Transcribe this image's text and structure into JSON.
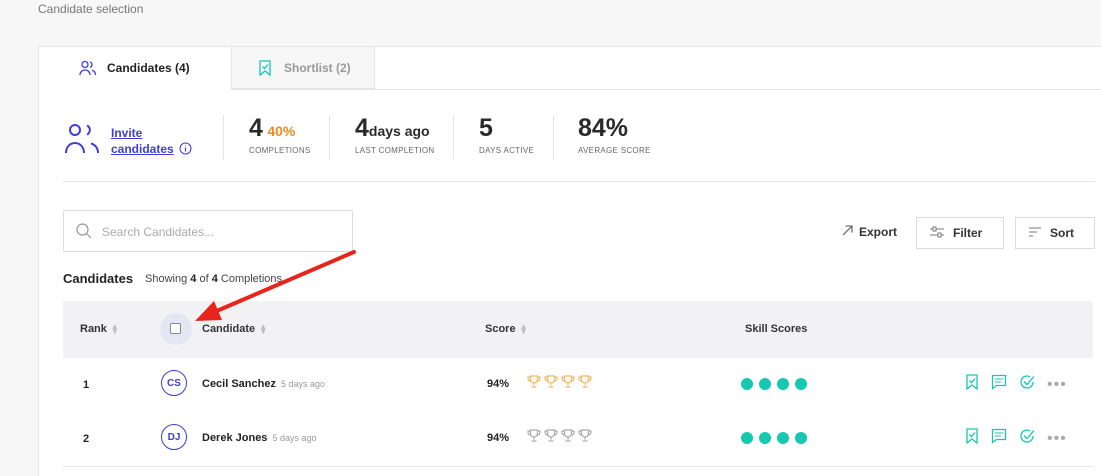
{
  "breadcrumb": "Candidate selection",
  "tabs": [
    {
      "label": "Candidates (4)",
      "icon": "users-icon"
    },
    {
      "label": "Shortlist (2)",
      "icon": "bookmark-check-icon"
    }
  ],
  "invite": {
    "line1": "Invite",
    "line2": "candidates"
  },
  "stats": {
    "completions": {
      "value": "4",
      "percent": "40%",
      "caption": "COMPLETIONS"
    },
    "last_completion": {
      "value": "4",
      "suffix": "days ago",
      "caption": "LAST COMPLETION"
    },
    "days_active": {
      "value": "5",
      "caption": "DAYS ACTIVE"
    },
    "average_score": {
      "value": "84%",
      "caption": "AVERAGE SCORE"
    }
  },
  "search": {
    "placeholder": "Search Candidates..."
  },
  "toolbar": {
    "export": "Export",
    "filter": "Filter",
    "sort": "Sort"
  },
  "list": {
    "title": "Candidates",
    "showing_prefix": "Showing",
    "shown": "4",
    "of": "of",
    "total": "4",
    "suffix": "Completions"
  },
  "columns": {
    "rank": "Rank",
    "candidate": "Candidate",
    "score": "Score",
    "skills": "Skill Scores"
  },
  "rows": [
    {
      "rank": "1",
      "initials": "CS",
      "name": "Cecil Sanchez",
      "when": "5 days ago",
      "score": "94%",
      "trophy_color": "#f2b866",
      "skills": 4
    },
    {
      "rank": "2",
      "initials": "DJ",
      "name": "Derek Jones",
      "when": "5 days ago",
      "score": "94%",
      "trophy_color": "#a9a9a9",
      "skills": 4
    }
  ],
  "colors": {
    "accent": "#3d3dd8",
    "teal": "#14c9b0",
    "orange": "#f08a1c",
    "arrow": "#e8251c"
  }
}
